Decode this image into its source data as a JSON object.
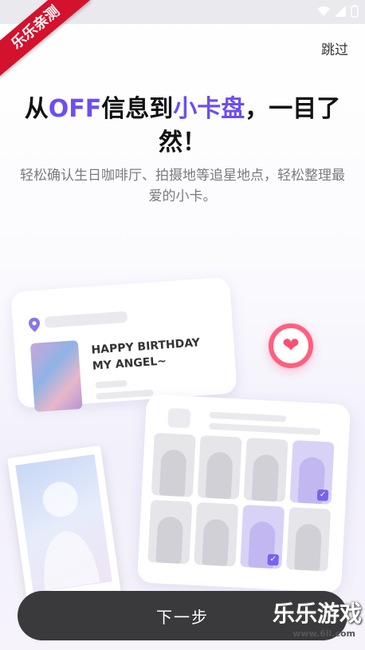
{
  "ribbon": {
    "label": "乐乐亲测"
  },
  "header": {
    "skip_label": "跳过"
  },
  "title": {
    "part1": "从",
    "highlight1": "OFF",
    "part2": "信息到",
    "highlight2": "小卡盘",
    "part3": "，一目了然！"
  },
  "subtitle": "轻松确认生日咖啡厅、拍摄地等追星地点，轻松整理最爱的小卡。",
  "event_card": {
    "text_line1": "HAPPY BIRTHDAY",
    "text_line2": "MY ANGEL~"
  },
  "grid_card": {
    "cells": [
      {
        "selected": false
      },
      {
        "selected": false
      },
      {
        "selected": false
      },
      {
        "selected": true
      },
      {
        "selected": false
      },
      {
        "selected": false
      },
      {
        "selected": true
      },
      {
        "selected": false
      }
    ]
  },
  "footer": {
    "next_label": "下一步"
  },
  "watermark": {
    "brand": "乐乐游戏",
    "url": "www.6ll.com"
  },
  "colors": {
    "accent": "#6c4ef2",
    "heart": "#ff5f7e",
    "button": "#3a3a3c"
  }
}
